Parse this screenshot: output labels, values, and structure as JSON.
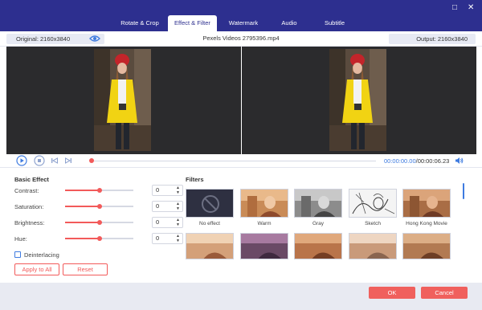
{
  "tabs": [
    {
      "label": "Rotate & Crop"
    },
    {
      "label": "Effect & Filter",
      "active": true
    },
    {
      "label": "Watermark"
    },
    {
      "label": "Audio"
    },
    {
      "label": "Subtitle"
    }
  ],
  "window_controls": {
    "maximize": "□",
    "close": "✕"
  },
  "info": {
    "original": "Original: 2160x3840",
    "filename": "Pexels Videos 2795396.mp4",
    "output": "Output: 2160x3840"
  },
  "playback": {
    "current_time": "00:00:00.00",
    "total_time": "/00:00:06.23",
    "progress": 0.0
  },
  "basic_effect": {
    "title": "Basic Effect",
    "adjustments": [
      {
        "label": "Contrast:",
        "value": "0",
        "level": 0.5
      },
      {
        "label": "Saturation:",
        "value": "0",
        "level": 0.5
      },
      {
        "label": "Brightness:",
        "value": "0",
        "level": 0.5
      },
      {
        "label": "Hue:",
        "value": "0",
        "level": 0.5
      }
    ],
    "deinterlacing": "Deinterlacing",
    "apply_all": "Apply to All",
    "reset": "Reset"
  },
  "filters": {
    "title": "Filters",
    "items": [
      {
        "name": "No effect"
      },
      {
        "name": "Warm"
      },
      {
        "name": "Gray"
      },
      {
        "name": "Sketch"
      },
      {
        "name": "Hong Kong Movie"
      }
    ]
  },
  "footer": {
    "ok": "OK",
    "cancel": "Cancel"
  },
  "colors": {
    "accent": "#2d2f8f",
    "primary": "#f0605d",
    "link": "#3e7be0"
  }
}
